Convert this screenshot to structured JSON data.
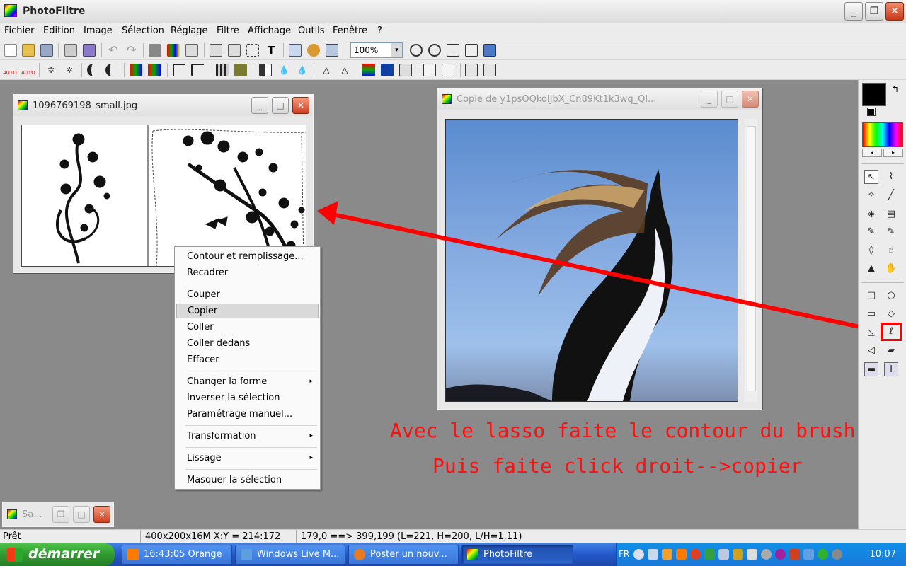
{
  "app": {
    "title": "PhotoFiltre",
    "min": "_",
    "max": "❐",
    "close": "✕"
  },
  "menu": [
    "Fichier",
    "Edition",
    "Image",
    "Sélection",
    "Réglage",
    "Filtre",
    "Affichage",
    "Outils",
    "Fenêtre",
    "?"
  ],
  "toolbar": {
    "zoom_value": "100%",
    "zoom_dd": "▾",
    "auto1": "AUTO",
    "auto2": "AUTO",
    "text_tool": "T"
  },
  "doc1": {
    "title": "1096769198_small.jpg",
    "min": "_",
    "max": "□",
    "close": "✕"
  },
  "doc2": {
    "title": "Copie de y1psOQkoIJbX_Cn89Kt1k3wq_Ql...",
    "min": "_",
    "max": "□",
    "close": "✕"
  },
  "doc3": {
    "title": "Sa...",
    "restore": "❐",
    "max": "□",
    "close": "✕"
  },
  "context_menu": {
    "items": [
      "Contour et remplissage...",
      "Recadrer",
      "Couper",
      "Copier",
      "Coller",
      "Coller dedans",
      "Effacer",
      "Changer la forme",
      "Inverser la sélection",
      "Paramétrage manuel...",
      "Transformation",
      "Lissage",
      "Masquer la sélection"
    ],
    "highlighted": "Copier",
    "submenu_arrow": "▸"
  },
  "annotation": {
    "line1": "Avec le lasso faite le contour du brush",
    "line2": "Puis faite click droit-->copier",
    "color": "#ff1010"
  },
  "statusbar": {
    "state": "Prêt",
    "info": "400x200x16M  X:Y = 214:172",
    "selection": "179,0 ==> 399,199 (L=221, H=200, L/H=1,11)"
  },
  "taskbar": {
    "start": "démarrer",
    "tasks": [
      "16:43:05 Orange",
      "Windows Live M...",
      "Poster un nouv...",
      "PhotoFiltre"
    ],
    "lang": "FR",
    "clock": "10:07"
  },
  "colors": {
    "foreground": "#000000",
    "background": "#ffffff",
    "highlight_box": "#ff0000"
  }
}
